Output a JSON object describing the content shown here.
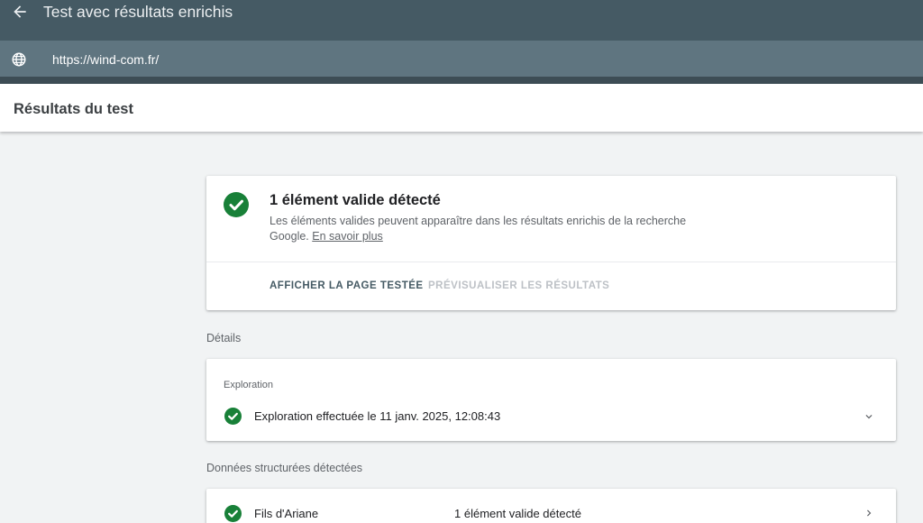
{
  "app": {
    "title": "Test avec résultats enrichis",
    "url": "https://wind-com.fr/"
  },
  "results_header": {
    "title": "Résultats du test"
  },
  "summary": {
    "title": "1 élément valide détecté",
    "description": "Les éléments valides peuvent apparaître dans les résultats enrichis de la recherche Google.",
    "learn_more": "En savoir plus",
    "buttons": {
      "view_page": "AFFICHER LA PAGE TESTÉE",
      "preview": "PRÉVISUALISER LES RÉSULTATS"
    }
  },
  "details": {
    "label": "Détails",
    "crawl": {
      "heading": "Exploration",
      "status": "Exploration effectuée le 11 janv. 2025, 12:08:43"
    }
  },
  "structured_data": {
    "label": "Données structurées détectées",
    "items": [
      {
        "name": "Fils d'Ariane",
        "status": "1 élément valide détecté"
      }
    ]
  },
  "icons": {
    "back": "arrow-back-icon",
    "url": "globe-icon",
    "valid": "check-circle-icon",
    "expand": "chevron-down-icon",
    "open": "chevron-right-icon"
  },
  "colors": {
    "topbar": "#455a64",
    "urlbar": "#5f7580",
    "success": "#188038",
    "button_active": "#455a64",
    "button_disabled": "#bdc1c6"
  }
}
